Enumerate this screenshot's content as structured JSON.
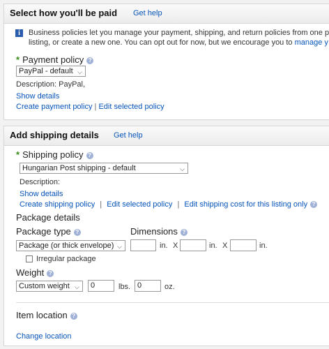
{
  "payment": {
    "title": "Select how you'll be paid",
    "get_help": "Get help",
    "info_line1": "Business policies let you manage your payment, shipping, and return policies from one p",
    "info_line2_prefix": "listing, or create a new one. You can opt out for now, but we encourage you to ",
    "info_line2_link": "manage y",
    "policy_label": "Payment policy",
    "policy_select": "PayPal - default",
    "description": "Description: PayPal,",
    "show_details": "Show details",
    "create_policy": "Create payment policy",
    "separator": "|",
    "edit_selected": "Edit selected policy"
  },
  "shipping": {
    "title": "Add shipping details",
    "get_help": "Get help",
    "policy_label": "Shipping policy",
    "policy_select": "Hungarian Post shipping - default",
    "description": "Description:",
    "show_details": "Show details",
    "create_policy": "Create shipping policy",
    "separator": "|",
    "edit_selected": "Edit selected policy",
    "edit_cost": "Edit shipping cost for this listing only",
    "package_details": "Package details",
    "package_type_label": "Package type",
    "package_type_select": "Package (or thick envelope)",
    "dimensions_label": "Dimensions",
    "dim_unit": "in.",
    "dim_x": "X",
    "dim1": "",
    "dim2": "",
    "dim3": "",
    "irregular_label": "Irregular package",
    "weight_label": "Weight",
    "weight_select": "Custom weight",
    "weight_lbs": "0",
    "weight_lbs_unit": "lbs.",
    "weight_oz": "0",
    "weight_oz_unit": "oz.",
    "item_location_label": "Item location",
    "change_location": "Change location"
  },
  "icons": {
    "help": "?",
    "info": "i",
    "chevron": "⌵",
    "required": "*"
  }
}
